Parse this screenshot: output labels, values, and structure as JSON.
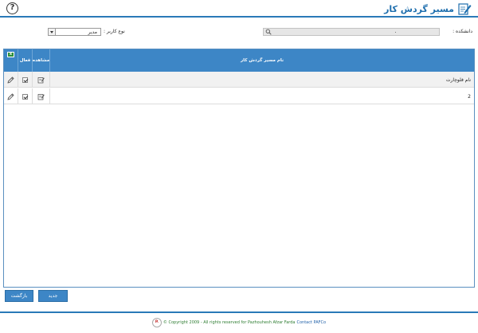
{
  "header": {
    "title": "مسیر گردش کار",
    "help_label": "?"
  },
  "filters": {
    "university_label": "دانشکده :",
    "user_type_label": "نوع کاربر :",
    "user_type_value": "مدیر"
  },
  "table": {
    "columns": {
      "view": "مشاهده",
      "active": "فعال",
      "name": "نام مسیر گردش کار"
    },
    "rows": [
      {
        "name": "نام فلوچارت",
        "active": true
      },
      {
        "name": "2",
        "active": true
      }
    ]
  },
  "buttons": {
    "back": "بازگشت",
    "new": "جدید"
  },
  "footer": {
    "logo_text": "P.",
    "copyright": "© Copyright 2009 - All rights reserved for Pazhouhesh Afzar Farda",
    "contact": "Contact PAFCo"
  },
  "colors": {
    "accent": "#3d86c6",
    "title": "#1f6fae",
    "footer_text": "#2e7d32"
  }
}
